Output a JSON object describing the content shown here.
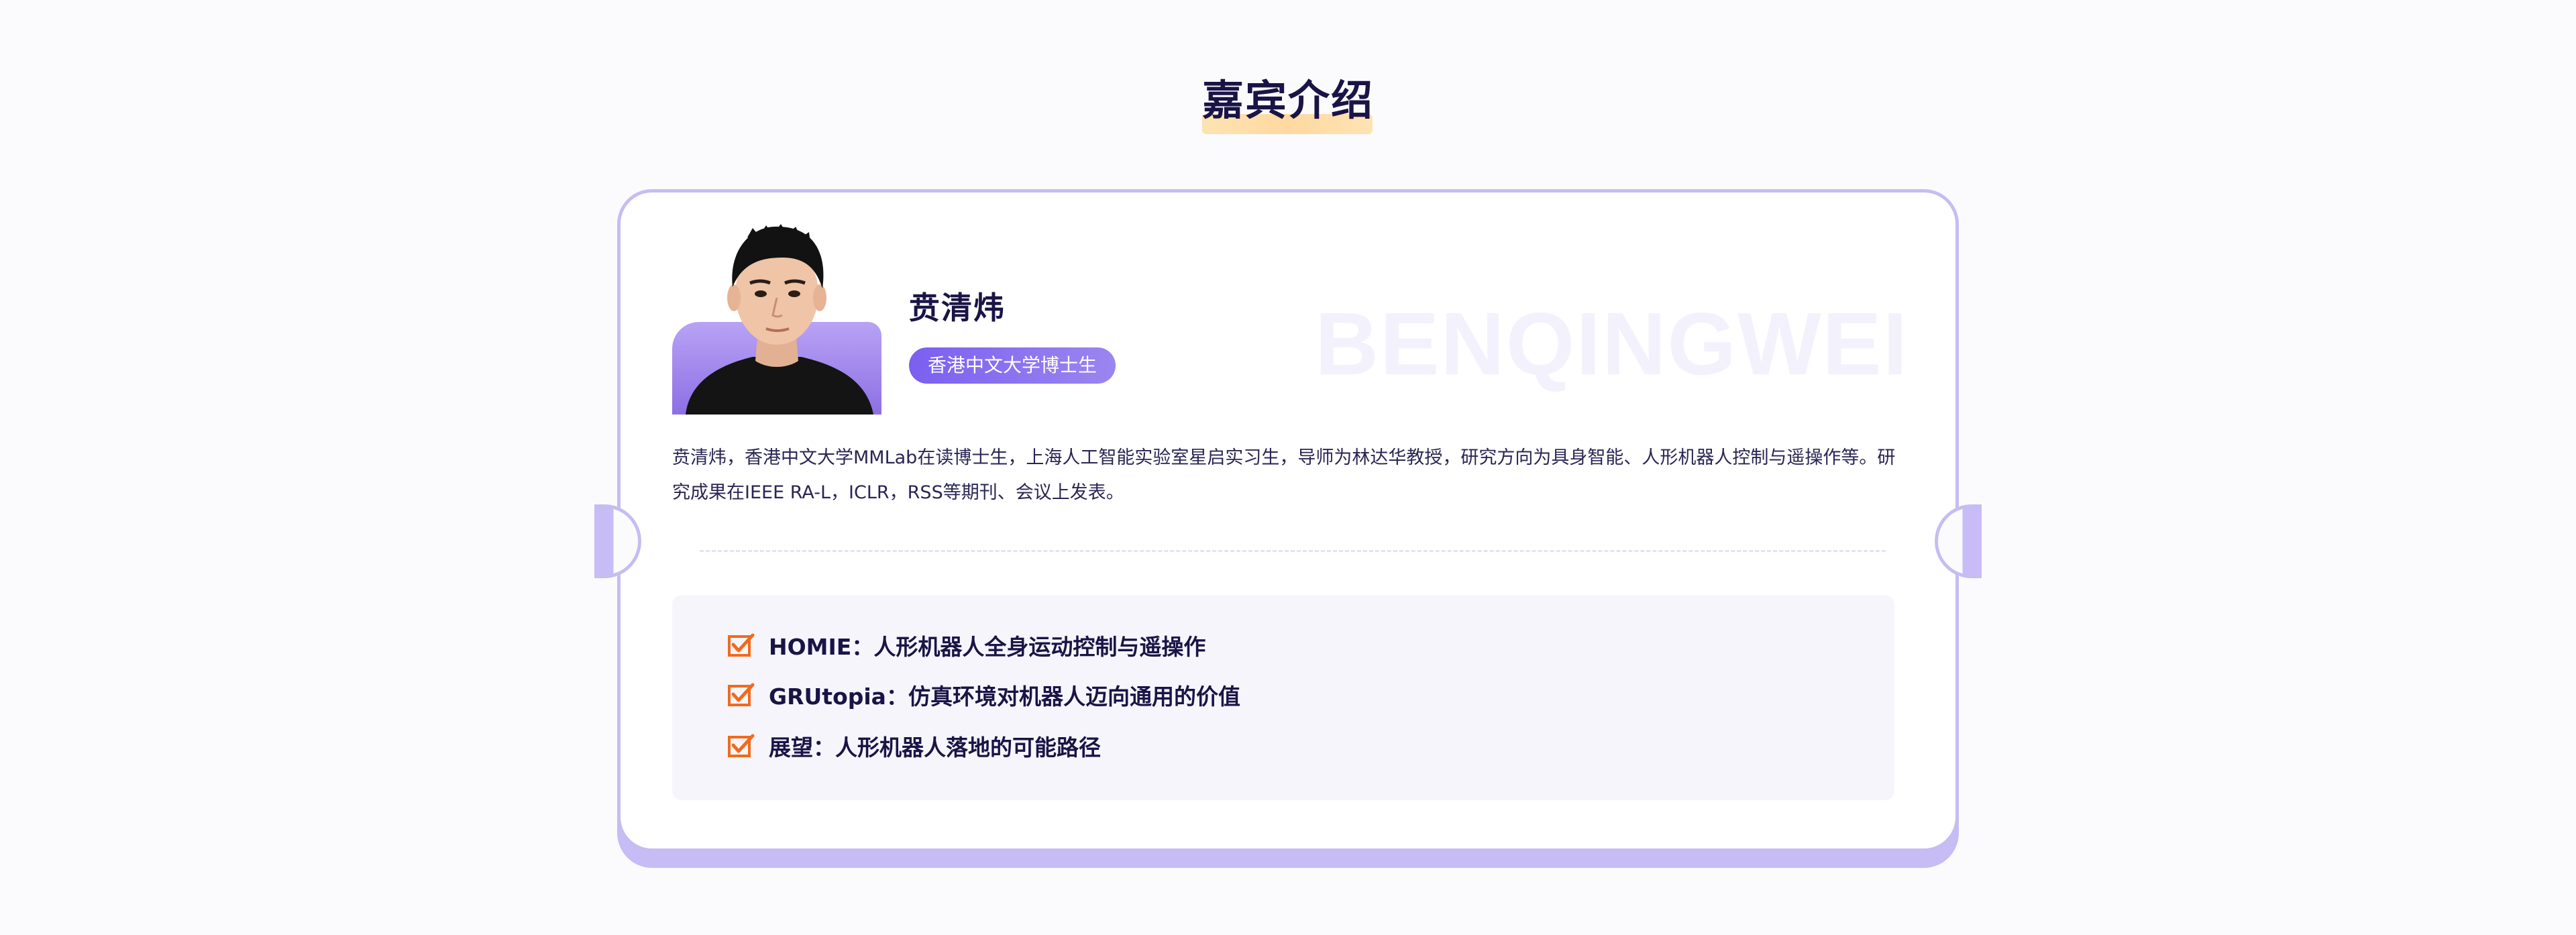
{
  "section": {
    "title": "嘉宾介绍"
  },
  "guest": {
    "name": "贲清炜",
    "watermark": "BENQINGWEI",
    "badge": "香港中文大学博士生",
    "bio": "贲清炜，香港中文大学MMLab在读博士生，上海人工智能实验室星启实习生，导师为林达华教授，研究方向为具身智能、人形机器人控制与遥操作等。研究成果在IEEE RA-L，ICLR，RSS等期刊、会议上发表。"
  },
  "topics": [
    {
      "text": "HOMIE：人形机器人全身运动控制与遥操作",
      "icon": "checkbox-checked-icon"
    },
    {
      "text": "GRUtopia：仿真环境对机器人迈向通用的价值",
      "icon": "checkbox-checked-icon"
    },
    {
      "text": "展望：人形机器人落地的可能路径",
      "icon": "checkbox-checked-icon"
    }
  ],
  "colors": {
    "accent": "#7b5ff0",
    "card_border": "#c6bdf2",
    "check": "#f26a1b",
    "title": "#1a1446"
  }
}
